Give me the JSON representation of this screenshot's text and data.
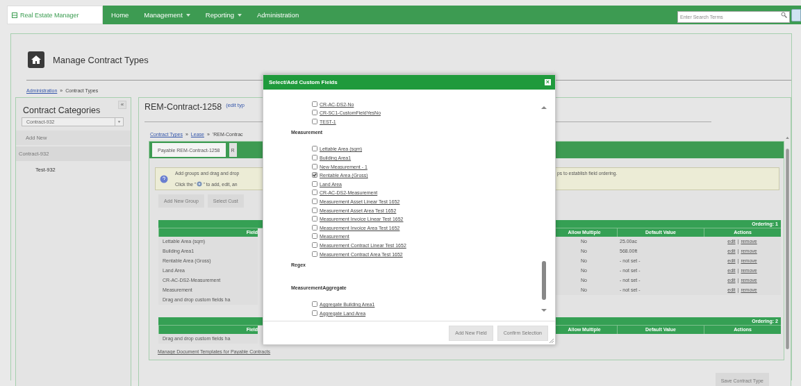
{
  "nav": {
    "logo": "Real Estate Manager",
    "items": [
      {
        "label": "Home",
        "dropdown": false
      },
      {
        "label": "Management",
        "dropdown": true
      },
      {
        "label": "Reporting",
        "dropdown": true
      },
      {
        "label": "Administration",
        "dropdown": false
      }
    ],
    "search": {
      "placeholder": "Enter Search Terms"
    }
  },
  "page": {
    "title": "Manage Contract Types",
    "breadcrumb": {
      "links": [
        "Administration"
      ],
      "separator": "»",
      "current": "Contract Types"
    }
  },
  "categories": {
    "title": "Contract Categories",
    "collapse": "«",
    "select": "Contract-932",
    "add_new": "Add New",
    "items": [
      {
        "label": "Contract-932",
        "selected": true,
        "children": [
          {
            "label": "Test-932",
            "selected": false
          }
        ]
      }
    ]
  },
  "contract": {
    "title": "REM-Contract-1258",
    "edit_link": "(edit typ",
    "breadcrumb": {
      "links": [
        "Contract Types",
        "Lease"
      ],
      "separator": "»",
      "current": "'REM-Contrac"
    },
    "tabs": [
      {
        "label": "Payable REM-Contract-1258",
        "selected": true
      },
      {
        "label": "R",
        "selected": false
      }
    ],
    "info": {
      "line1_left": "Add groups and drag and drop",
      "line1_right": "ps to establish field ordering.",
      "line2_before": "Click the \"",
      "line2_after": "\" to add, edit, an"
    },
    "buttons": [
      "Add New Group",
      "Select Cust"
    ],
    "tables": [
      {
        "ordering": "Ordering: 1",
        "columns": [
          "Field",
          "Allow Multiple",
          "Default Value",
          "Actions"
        ],
        "action_separator": "|",
        "rows": [
          {
            "field": "Lettable Area (sqm)",
            "allow_multiple": "No",
            "default_value": "25.00ac",
            "actions": [
              "edit",
              "remove"
            ]
          },
          {
            "field": "Building Area1",
            "allow_multiple": "No",
            "default_value": "568.00ft",
            "actions": [
              "edit",
              "remove"
            ]
          },
          {
            "field": "Rentable Area (Gross)",
            "allow_multiple": "No",
            "default_value": "- not set -",
            "actions": [
              "edit",
              "remove"
            ]
          },
          {
            "field": "Land Area",
            "allow_multiple": "No",
            "default_value": "- not set -",
            "actions": [
              "edit",
              "remove"
            ]
          },
          {
            "field": "CR-AC-DS2-Measurement",
            "allow_multiple": "No",
            "default_value": "- not set -",
            "actions": [
              "edit",
              "remove"
            ]
          },
          {
            "field": "Measurement",
            "allow_multiple": "No",
            "default_value": "- not set -",
            "actions": [
              "edit",
              "remove"
            ]
          }
        ],
        "footer": "Drag and drop custom fields ha"
      },
      {
        "ordering": "Ordering: 2",
        "columns": [
          "Field",
          "Allow Multiple",
          "Default Value",
          "Actions"
        ],
        "footer": "Drag and drop custom fields ha"
      }
    ],
    "templates_link": "Manage Document Templates for Payable Contracts",
    "save": "Save Contract Type"
  },
  "modal": {
    "title": "Select/Add Custom Fields",
    "close": "×",
    "groups": [
      {
        "items": [
          {
            "label": "CR-AC-DS2-No",
            "checked": false
          },
          {
            "label": "CR-SC1-CustomFieldYesNo",
            "checked": false
          },
          {
            "label": "TEST-1",
            "checked": false
          }
        ]
      },
      {
        "title": "Measurement",
        "items": [
          {
            "label": "Lettable Area (sqm)",
            "checked": false
          },
          {
            "label": "Building Area1",
            "checked": false
          },
          {
            "label": "New Measurement - 1",
            "checked": false
          },
          {
            "label": "Rentable Area (Gross)",
            "checked": true
          },
          {
            "label": "Land Area",
            "checked": false
          },
          {
            "label": "CR-AC-DS2-Measurement",
            "checked": false
          },
          {
            "label": "Measurement Asset Linear Test 1652",
            "checked": false
          },
          {
            "label": "Measurement Asset Area Test 1652",
            "checked": false
          },
          {
            "label": "Measurement Invoice Linear Test 1652",
            "checked": false
          },
          {
            "label": "Measurement Invoice Area Test 1652",
            "checked": false
          },
          {
            "label": "Measurement",
            "checked": false
          },
          {
            "label": "Measurement Contract Linear Test 1652",
            "checked": false
          },
          {
            "label": "Measurement Contract Area Test 1652",
            "checked": false
          }
        ]
      },
      {
        "title": "Regex"
      },
      {
        "title": "MeasurementAggregate",
        "items": [
          {
            "label": "Aggregate Building Area1",
            "checked": false
          },
          {
            "label": "Aggregate Land Area",
            "checked": false
          }
        ]
      }
    ],
    "buttons": [
      "Add New Field",
      "Confirm Selection"
    ]
  }
}
